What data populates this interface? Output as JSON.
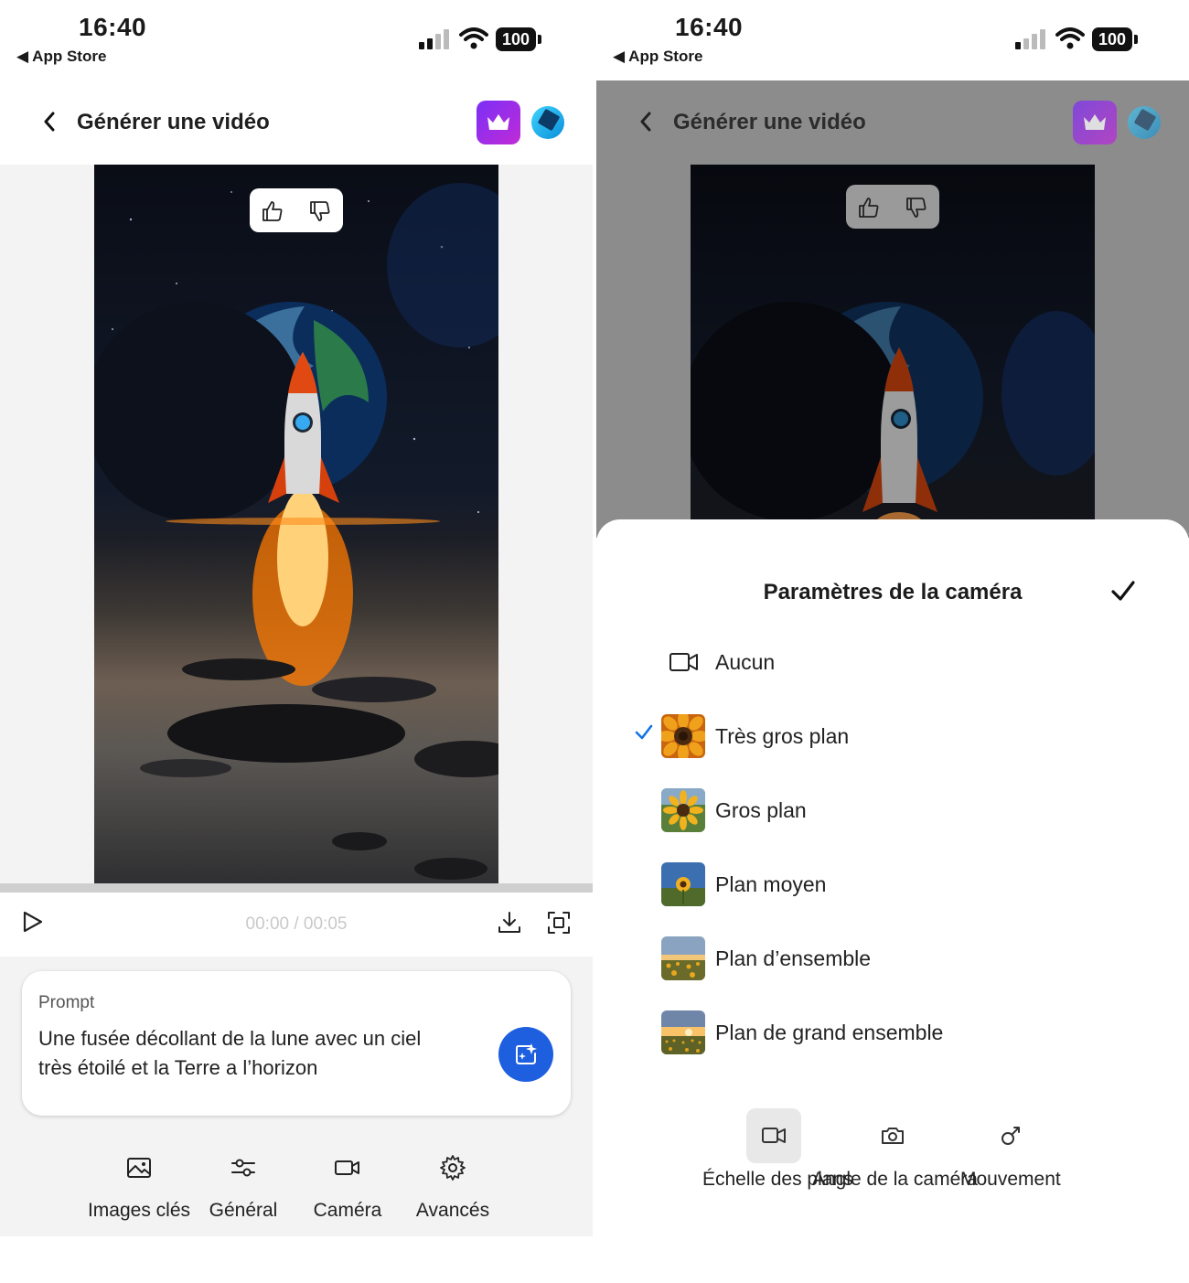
{
  "status_bar": {
    "time": "16:40",
    "back_app": "App Store",
    "battery": "100"
  },
  "header": {
    "title": "Générer une vidéo"
  },
  "player": {
    "timecode": "00:00 / 00:05"
  },
  "prompt": {
    "label": "Prompt",
    "text": "Une fusée décollant de la lune avec un ciel très étoilé et la Terre a l’horizon"
  },
  "toolbar": [
    {
      "label": "Images clés",
      "icon": "image-icon"
    },
    {
      "label": "Général",
      "icon": "sliders-icon"
    },
    {
      "label": "Caméra",
      "icon": "video-camera-icon"
    },
    {
      "label": "Avancés",
      "icon": "gear-icon"
    }
  ],
  "camera_sheet": {
    "title": "Paramètres de la caméra",
    "selected": "Très gros plan",
    "options": [
      {
        "label": "Aucun",
        "thumbnail": "video-camera-icon"
      },
      {
        "label": "Très gros plan",
        "thumbnail": "sunflower-extreme-closeup"
      },
      {
        "label": "Gros plan",
        "thumbnail": "sunflower-closeup"
      },
      {
        "label": "Plan moyen",
        "thumbnail": "sunflower-medium"
      },
      {
        "label": "Plan d’ensemble",
        "thumbnail": "sunflower-wide"
      },
      {
        "label": "Plan de grand ensemble",
        "thumbnail": "sunflower-extreme-wide"
      }
    ],
    "tabs": [
      {
        "label": "Échelle des plans",
        "icon": "video-camera-icon",
        "active": true
      },
      {
        "label": "Angle de la caméra",
        "icon": "camera-icon",
        "active": false
      },
      {
        "label": "Mouvement",
        "icon": "movement-icon",
        "active": false
      }
    ]
  },
  "colors": {
    "accent_blue": "#1e5fe0",
    "premium_purple": "#7b2ff7",
    "check_blue": "#1473e6"
  }
}
